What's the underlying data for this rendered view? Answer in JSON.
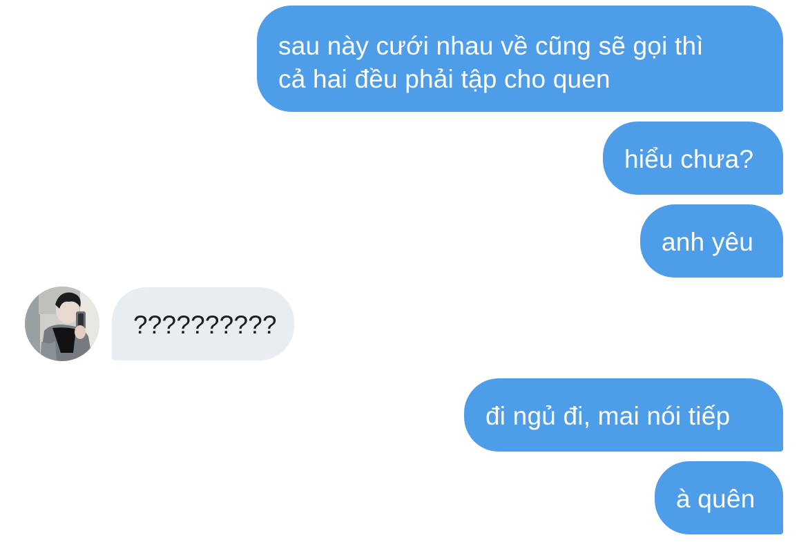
{
  "messages": [
    {
      "from": "me",
      "lines": [
        "sau này cưới nhau về cũng sẽ gọi thì",
        "cả hai đều phải tập cho quen"
      ]
    },
    {
      "from": "me",
      "lines": [
        "hiểu chưa?"
      ]
    },
    {
      "from": "me",
      "lines": [
        "anh yêu"
      ]
    },
    {
      "from": "them",
      "lines": [
        "??????????"
      ]
    },
    {
      "from": "me",
      "lines": [
        "đi ngủ đi, mai nói tiếp"
      ]
    },
    {
      "from": "me",
      "lines": [
        "à quên"
      ]
    }
  ],
  "colors": {
    "sent_bubble": "#4d9de9",
    "sent_text": "#ffffff",
    "received_bubble": "#e8edf1",
    "received_text": "#1a1d21",
    "background": "#ffffff"
  },
  "contact": {
    "avatar_icon": "profile-photo"
  }
}
